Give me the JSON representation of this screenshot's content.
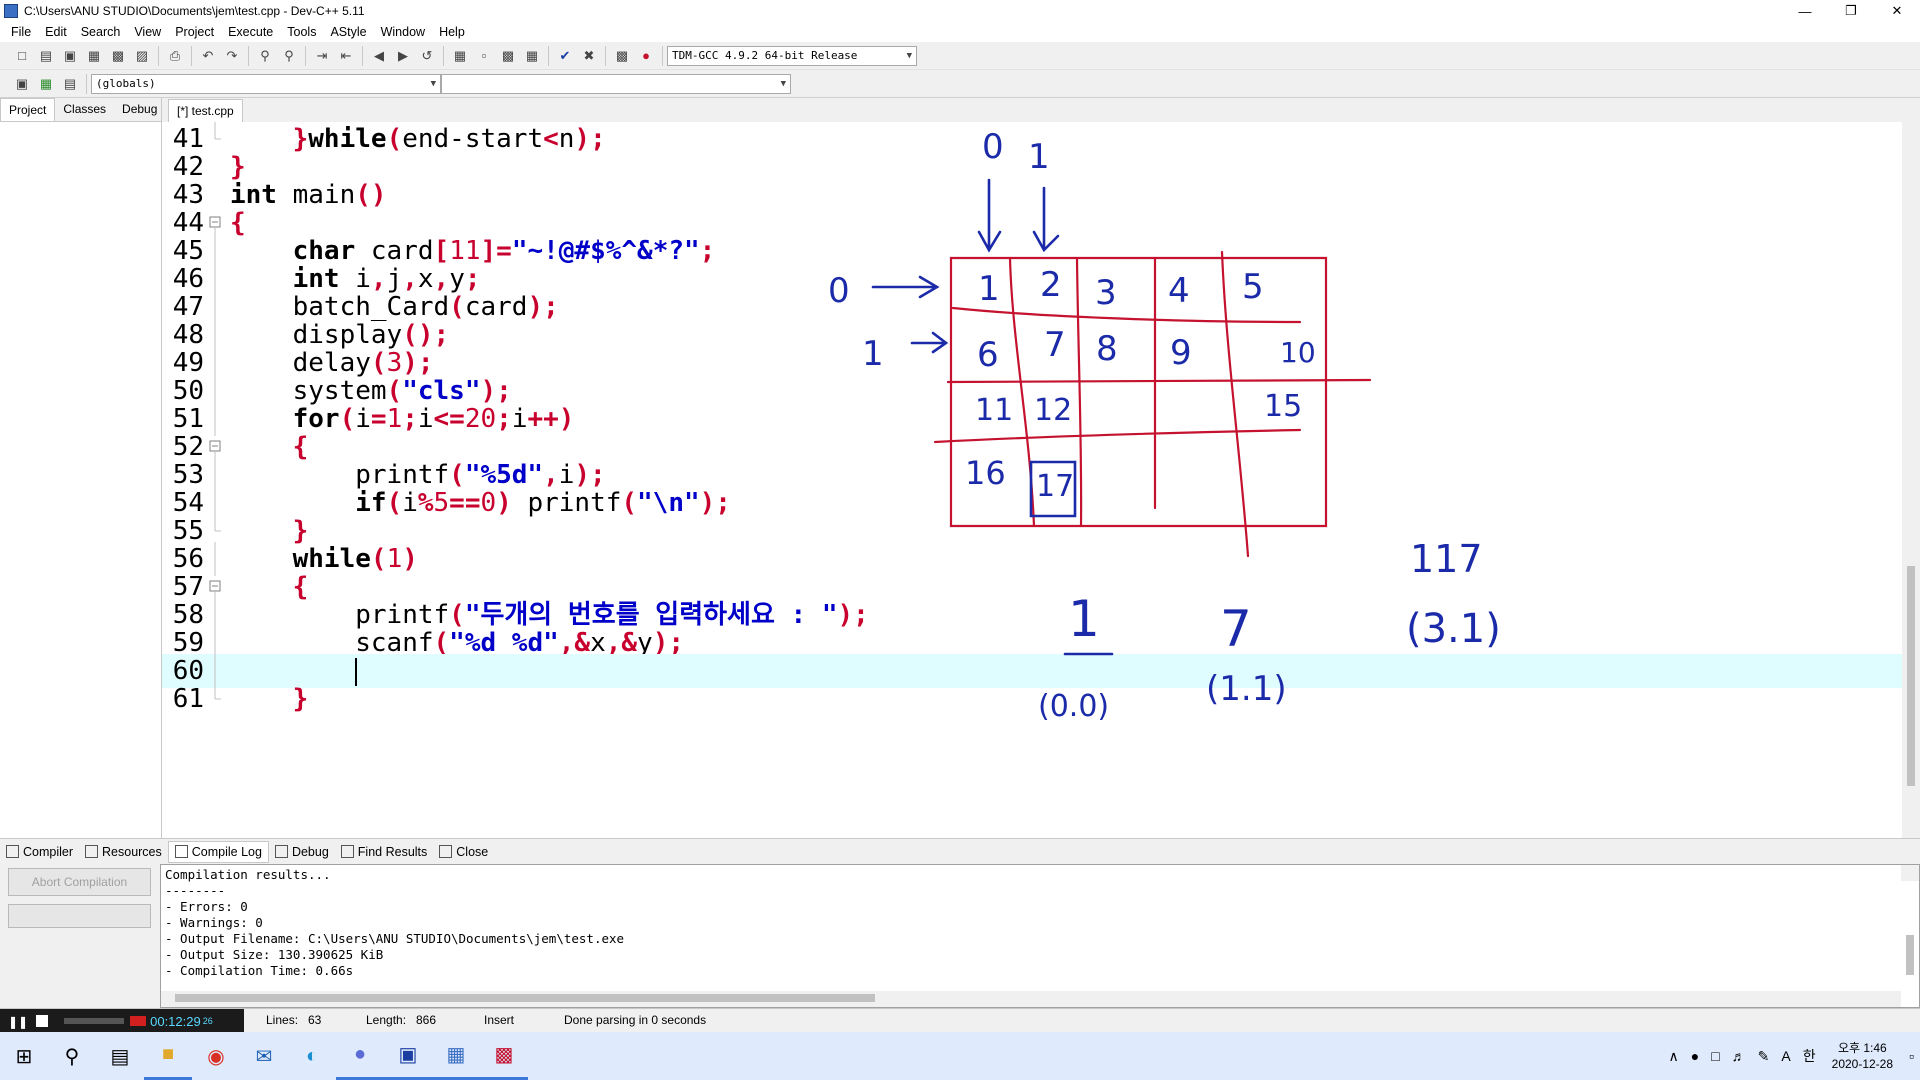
{
  "window": {
    "title": "C:\\Users\\ANU STUDIO\\Documents\\jem\\test.cpp - Dev-C++ 5.11",
    "minimize": "—",
    "restore": "❐",
    "close": "✕"
  },
  "menu": [
    "File",
    "Edit",
    "Search",
    "View",
    "Project",
    "Execute",
    "Tools",
    "AStyle",
    "Window",
    "Help"
  ],
  "toolbar": {
    "compiler_select": "TDM-GCC 4.9.2 64-bit Release",
    "scope_select": "(globals)",
    "function_select": ""
  },
  "left_tabs": [
    "Project",
    "Classes",
    "Debug"
  ],
  "editor": {
    "tab": "[*] test.cpp",
    "lines": [
      {
        "n": "41",
        "fold": "end"
      },
      {
        "n": "42",
        "fold": "none"
      },
      {
        "n": "43",
        "fold": "none"
      },
      {
        "n": "44",
        "fold": "box"
      },
      {
        "n": "45",
        "fold": "line"
      },
      {
        "n": "46",
        "fold": "line"
      },
      {
        "n": "47",
        "fold": "line"
      },
      {
        "n": "48",
        "fold": "line"
      },
      {
        "n": "49",
        "fold": "line"
      },
      {
        "n": "50",
        "fold": "line"
      },
      {
        "n": "51",
        "fold": "line"
      },
      {
        "n": "52",
        "fold": "box"
      },
      {
        "n": "53",
        "fold": "line"
      },
      {
        "n": "54",
        "fold": "line"
      },
      {
        "n": "55",
        "fold": "end"
      },
      {
        "n": "56",
        "fold": "line"
      },
      {
        "n": "57",
        "fold": "box"
      },
      {
        "n": "58",
        "fold": "line"
      },
      {
        "n": "59",
        "fold": "line"
      },
      {
        "n": "60",
        "fold": "line"
      },
      {
        "n": "61",
        "fold": "end"
      }
    ],
    "code": {
      "l41": {
        "a": "}",
        "b": "while",
        "c": "(",
        "d": "end-start",
        "e": "<",
        "f": "n",
        "g": ");"
      },
      "l42": {
        "a": "}"
      },
      "l43": {
        "a": "int",
        "b": " main",
        "c": "()"
      },
      "l44": {
        "a": "{"
      },
      "l45": {
        "a": "char",
        "b": " card",
        "c": "[",
        "d": "11",
        "e": "]=",
        "f": "\"~!@#$%^&*?\"",
        "g": ";"
      },
      "l46": {
        "a": "int",
        "b": " i",
        "c": ",",
        "d": "j",
        "e": ",",
        "f": "x",
        "g": ",",
        "h": "y",
        "i": ";"
      },
      "l47": {
        "a": "batch_Card",
        "b": "(",
        "c": "card",
        "d": ");"
      },
      "l48": {
        "a": "display",
        "b": "();"
      },
      "l49": {
        "a": "delay",
        "b": "(",
        "c": "3",
        "d": ");"
      },
      "l50": {
        "a": "system",
        "b": "(",
        "c": "\"cls\"",
        "d": ");"
      },
      "l51": {
        "a": "for",
        "b": "(",
        "c": "i",
        "d": "=",
        "e": "1",
        "f": ";",
        "g": "i",
        "h": "<=",
        "i": "20",
        "j": ";",
        "k": "i",
        "l": "++)"
      },
      "l52": {
        "a": "{"
      },
      "l53": {
        "a": "printf",
        "b": "(",
        "c": "\"%5d\"",
        "d": ",",
        "e": "i",
        "f": ");"
      },
      "l54": {
        "a": "if",
        "b": "(",
        "c": "i",
        "d": "%",
        "e": "5",
        "f": "==",
        "g": "0",
        "h": ")",
        "i": " printf",
        "j": "(",
        "k": "\"\\n\"",
        "l": ");"
      },
      "l55": {
        "a": "}"
      },
      "l56": {
        "a": "while",
        "b": "(",
        "c": "1",
        "d": ")"
      },
      "l57": {
        "a": "{"
      },
      "l58": {
        "a": "printf",
        "b": "(",
        "c": "\"두개의 번호를 입력하세요 : \"",
        "d": ");"
      },
      "l59": {
        "a": "scanf",
        "b": "(",
        "c": "\"%d %d\"",
        "d": ",&",
        "e": "x",
        "f": ",&",
        "g": "y",
        "h": ");"
      },
      "l61": {
        "a": "}"
      }
    }
  },
  "drawing": {
    "col_labels": [
      "0",
      "1"
    ],
    "row_labels": [
      "0",
      "1"
    ],
    "grid_numbers": [
      "1",
      "2",
      "3",
      "4",
      "5",
      "6",
      "7",
      "8",
      "9",
      "10",
      "11",
      "12",
      "15",
      "16",
      "17"
    ],
    "notes": [
      "1",
      "(0.0)",
      "7",
      "(1.1)",
      "117",
      "(3.1)"
    ],
    "ink_blue": "#1b2aa8",
    "ink_red": "#c4122f"
  },
  "bottom_tabs": [
    "Compiler",
    "Resources",
    "Compile Log",
    "Debug",
    "Find Results",
    "Close"
  ],
  "compile": {
    "abort_button": "Abort Compilation",
    "log": [
      "Compilation results...",
      "--------",
      "- Errors: 0",
      "- Warnings: 0",
      "- Output Filename: C:\\Users\\ANU STUDIO\\Documents\\jem\\test.exe",
      "- Output Size: 130.390625 KiB",
      "- Compilation Time: 0.66s"
    ]
  },
  "recorder": {
    "time": "00:12:29",
    "frames": "26"
  },
  "status": {
    "lines": "Lines:",
    "lines_value": "63",
    "length": "Length:",
    "length_value": "866",
    "mode": "Insert",
    "parse": "Done parsing in 0 seconds"
  },
  "taskbar": {
    "clock_line1": "오후 1:46",
    "clock_line2": "2020-12-28",
    "ime": "한",
    "lang": "A"
  }
}
